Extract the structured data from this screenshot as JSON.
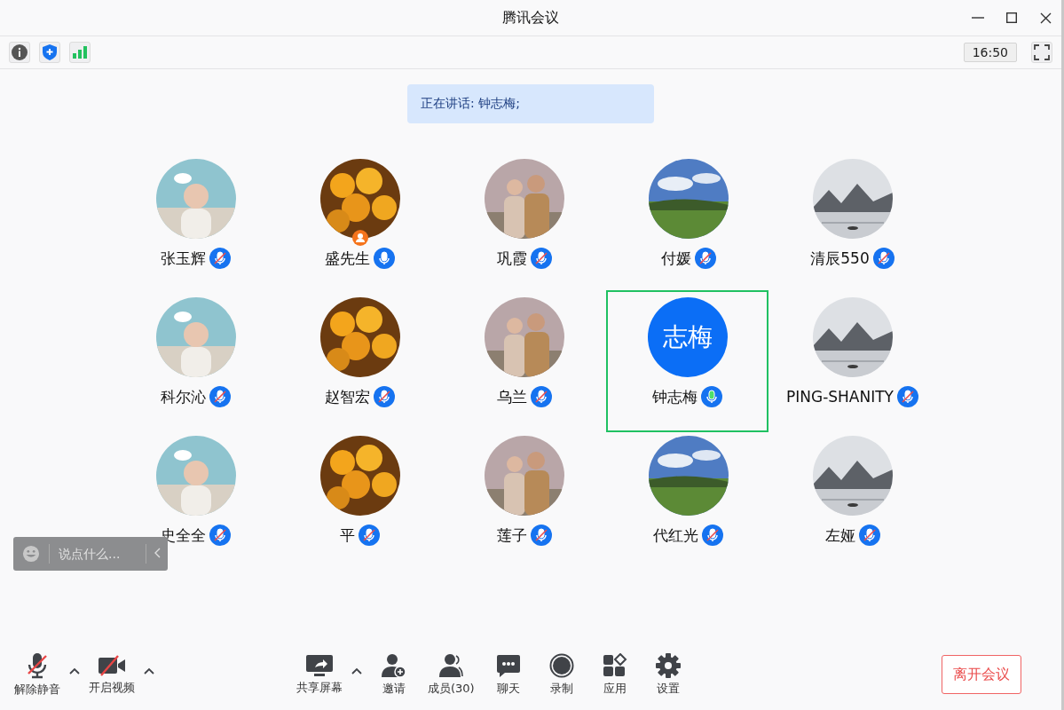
{
  "window": {
    "title": "腾讯会议"
  },
  "top_bar": {
    "time": "16:50"
  },
  "speaking_banner": "正在讲话: 钟志梅;",
  "participants": [
    {
      "name": "张玉辉",
      "muted": true,
      "host": false,
      "speaking": false
    },
    {
      "name": "盛先生",
      "muted": false,
      "host": true,
      "speaking": false
    },
    {
      "name": "巩霞",
      "muted": true,
      "host": false,
      "speaking": false
    },
    {
      "name": "付媛",
      "muted": true,
      "host": false,
      "speaking": false
    },
    {
      "name": "清辰550",
      "muted": true,
      "host": false,
      "speaking": false
    },
    {
      "name": "科尔沁",
      "muted": true,
      "host": false,
      "speaking": false
    },
    {
      "name": "赵智宏",
      "muted": true,
      "host": false,
      "speaking": false
    },
    {
      "name": "乌兰",
      "muted": true,
      "host": false,
      "speaking": false
    },
    {
      "name": "钟志梅",
      "muted": false,
      "host": false,
      "speaking": true,
      "avatar": {
        "kind": "initials",
        "text": "志梅"
      }
    },
    {
      "name": "PING-SHANITY",
      "muted": true,
      "host": false,
      "speaking": false
    },
    {
      "name": "史全全",
      "muted": true,
      "host": false,
      "speaking": false
    },
    {
      "name": "平",
      "muted": true,
      "host": false,
      "speaking": false
    },
    {
      "name": "莲子",
      "muted": true,
      "host": false,
      "speaking": false
    },
    {
      "name": "代红光",
      "muted": true,
      "host": false,
      "speaking": false
    },
    {
      "name": "左娅",
      "muted": true,
      "host": false,
      "speaking": false
    }
  ],
  "chat_input": {
    "placeholder": "说点什么..."
  },
  "toolbar": {
    "left": [
      {
        "kind": "mic",
        "label": "解除静音",
        "off": true,
        "menu": true
      },
      {
        "kind": "video",
        "label": "开启视频",
        "off": true,
        "menu": true
      }
    ],
    "center": [
      {
        "kind": "share",
        "label": "共享屏幕",
        "menu": true
      },
      {
        "kind": "invite",
        "label": "邀请",
        "menu": false
      },
      {
        "kind": "members",
        "label": "成员(30)",
        "menu": false
      },
      {
        "kind": "chat",
        "label": "聊天",
        "menu": false
      },
      {
        "kind": "record",
        "label": "录制",
        "menu": false
      },
      {
        "kind": "apps",
        "label": "应用",
        "menu": false
      },
      {
        "kind": "settings",
        "label": "设置",
        "menu": false
      }
    ],
    "leave_button": "离开会议"
  }
}
